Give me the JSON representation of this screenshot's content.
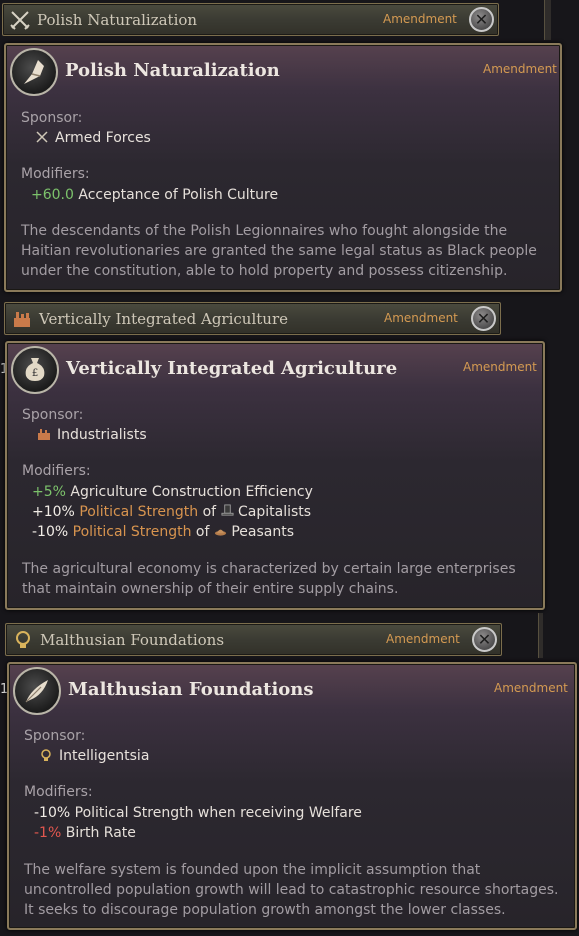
{
  "cards": [
    {
      "bar": {
        "title": "Polish Naturalization",
        "tag": "Amendment",
        "close": "✕"
      },
      "panel": {
        "title": "Polish Naturalization",
        "tag": "Amendment",
        "sponsor_label": "Sponsor:",
        "sponsor": "Armed Forces",
        "modifiers_label": "Modifiers:",
        "modifiers": [
          {
            "amount": "+60.0",
            "text": "Acceptance of Polish Culture"
          }
        ],
        "description": "The descendants of the Polish Legionnaires who fought alongside the Haitian revolutionaries are granted the same legal status as Black people under the constitution, able to hold property and possess citizenship."
      }
    },
    {
      "bar": {
        "title": "Vertically Integrated Agriculture",
        "tag": "Amendment",
        "close": "✕"
      },
      "panel": {
        "title": "Vertically Integrated Agriculture",
        "tag": "Amendment",
        "sponsor_label": "Sponsor:",
        "sponsor": "Industrialists",
        "modifiers_label": "Modifiers:",
        "modifiers": [
          {
            "amount": "+5%",
            "text": "Agriculture Construction Efficiency"
          },
          {
            "amount": "+10%",
            "text": "Political Strength",
            "of": "of",
            "group": "Capitalists"
          },
          {
            "amount": "-10%",
            "text": "Political Strength",
            "of": "of",
            "group": "Peasants"
          }
        ],
        "description": "The agricultural economy is characterized by certain large enterprises that maintain ownership of their entire supply chains."
      }
    },
    {
      "bar": {
        "title": "Malthusian Foundations",
        "tag": "Amendment",
        "close": "✕"
      },
      "panel": {
        "title": "Malthusian Foundations",
        "tag": "Amendment",
        "sponsor_label": "Sponsor:",
        "sponsor": "Intelligentsia",
        "modifiers_label": "Modifiers:",
        "modifiers": [
          {
            "amount": "-10%",
            "text": "Political Strength when receiving Welfare"
          },
          {
            "amount": "-1%",
            "text": "Birth Rate"
          }
        ],
        "description": "The welfare system is founded upon the implicit assumption that uncontrolled population growth will lead to catastrophic resource shortages. It seeks to discourage population growth amongst the lower classes."
      }
    }
  ],
  "side_marks": [
    "1",
    "1"
  ],
  "colors": {
    "positive": "#7cc26b",
    "negative": "#e1574f",
    "highlight": "#d8944f",
    "tag": "#d49a52"
  }
}
